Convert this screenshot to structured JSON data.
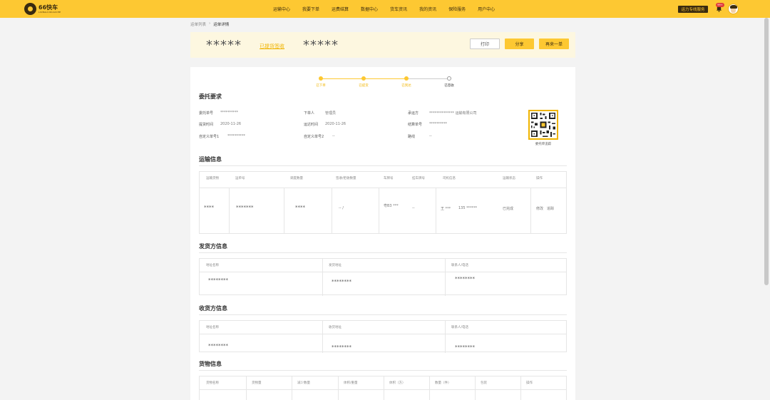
{
  "brand": {
    "name": "66快车",
    "sub": "LIUBALIUKUAICHE"
  },
  "nav": [
    "运输中心",
    "我要下单",
    "运费结算",
    "数据中心",
    "货车资讯",
    "我的资讯",
    "保险服务",
    "用户中心"
  ],
  "header_right": {
    "subscribe": "运力专线服务",
    "badge": "99+"
  },
  "breadcrumb": {
    "parent": "运单列表",
    "sep": "›",
    "current": "运单详情"
  },
  "order": {
    "masked_id": "*****",
    "status": "已提货签收",
    "masked_id2": "*****"
  },
  "actions": {
    "print": "打印",
    "share": "分享",
    "again": "再来一单"
  },
  "progress": [
    {
      "label": "已下单",
      "done": true
    },
    {
      "label": "已提货",
      "done": true
    },
    {
      "label": "已到达",
      "done": true
    },
    {
      "label": "已签收",
      "done": false
    }
  ],
  "sections": {
    "entrust": "委托要求",
    "transport": "运输信息",
    "shipper": "发货方信息",
    "receiver": "收货方信息",
    "goods": "货物信息"
  },
  "entrust": {
    "rows": [
      [
        {
          "k": "委托单号",
          "v": "**********"
        },
        {
          "k": "下单人",
          "v": "管理员"
        },
        {
          "k": "承运方",
          "v": "************** 运输有限公司"
        }
      ],
      [
        {
          "k": "提货时间",
          "v": "2020-11-26"
        },
        {
          "k": "运达时间",
          "v": "2020-11-26"
        },
        {
          "k": "结算单号",
          "v": "**********"
        }
      ],
      [
        {
          "k": "自定义单号1",
          "v": "**********"
        },
        {
          "k": "自定义单号2",
          "v": "--"
        },
        {
          "k": "路线",
          "v": "--"
        }
      ]
    ],
    "qr_caption": "委托单追踪"
  },
  "transport": {
    "headers": [
      "运输货物",
      "运单号",
      "调度数量",
      "签收/拒收数量",
      "车牌号",
      "挂车牌号",
      "司机信息",
      "运输状态",
      "操作"
    ],
    "row": {
      "goods": "****",
      "waybill": "*******",
      "qty": "****",
      "sign": "--   /",
      "plate": "粤B3 ***",
      "trailer": "--",
      "driver_name": "王 ***",
      "driver_phone": "135 ******",
      "status": "已完成",
      "op1": "修改",
      "op2": "追踪"
    }
  },
  "shipper": {
    "headers": [
      "地址名称",
      "发货地址",
      "联系人/电话"
    ],
    "values": [
      "********",
      "********",
      "********"
    ]
  },
  "receiver": {
    "headers": [
      "地址名称",
      "收货地址",
      "联系人/电话"
    ],
    "values": [
      "********",
      "********",
      "********"
    ]
  },
  "goods": {
    "headers": [
      "货物名称",
      "货物量",
      "减少数量",
      "体积/重量",
      "体积（方）",
      "数量（件）",
      "包装",
      "操作"
    ]
  }
}
